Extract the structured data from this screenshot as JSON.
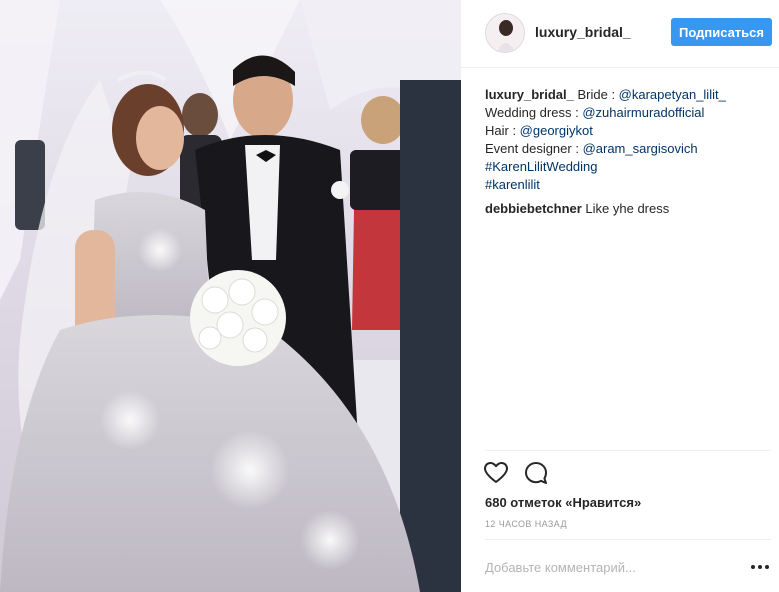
{
  "post": {
    "username": "luxury_bridal_",
    "follow_label": "Подписаться",
    "photo_icon": "wedding-photo",
    "caption": {
      "author": "luxury_bridal_",
      "line1_prefix": " Bride : ",
      "line1_mention": "@karapetyan_lilit_",
      "line2_prefix": "Wedding dress : ",
      "line2_mention": "@zuhairmuradofficial",
      "line3_prefix": "Hair : ",
      "line3_mention": "@georgiykot",
      "line4_prefix": "Event designer : ",
      "line4_mention": "@aram_sargisovich",
      "hashtag1": "#KarenLilitWedding",
      "hashtag2": "#karenlilit"
    },
    "comments": [
      {
        "user": "debbiebetchner",
        "text": " Like yhe dress"
      }
    ],
    "likes_text": "680 отметок «Нравится»",
    "time_text": "12 часов назад",
    "comment_placeholder": "Добавьте комментарий...",
    "icons": {
      "like": "heart-icon",
      "comment": "comment-icon",
      "more": "more-options-icon"
    },
    "colors": {
      "accent": "#3897f0",
      "link": "#003569",
      "text": "#262626",
      "muted": "#999999"
    }
  }
}
